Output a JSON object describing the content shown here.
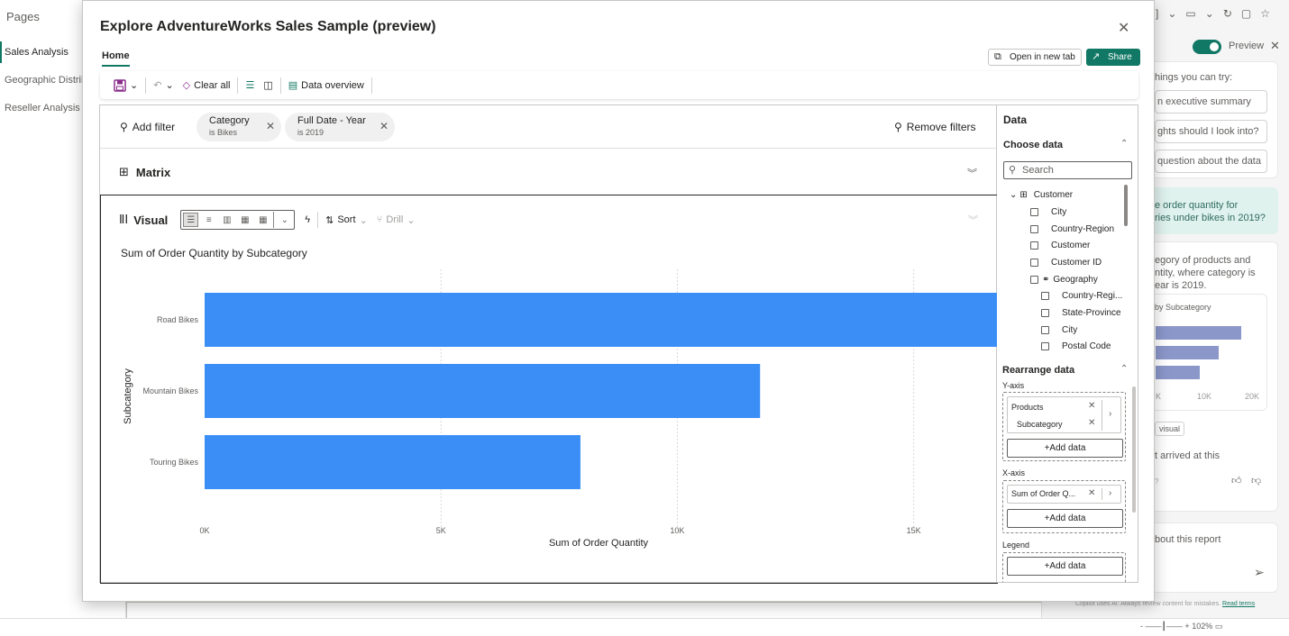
{
  "background": {
    "pages_title": "Pages",
    "pages": [
      "Sales Analysis",
      "Geographic Distrib",
      "Reseller Analysis"
    ]
  },
  "copilot": {
    "preview_label": "Preview",
    "things_try": "hings you can try:",
    "suggestions": [
      "n executive summary",
      "ghts should I look into?",
      "question about the data"
    ],
    "user_msg_1": "e order quantity for",
    "user_msg_2": "ries under bikes in 2019?",
    "resp_1": "egory of products and",
    "resp_2": "ntity, where category is",
    "resp_3": "ear is 2019.",
    "mini_chart_title": "by Subcategory",
    "mini_chart_values": [
      17500,
      13000,
      9000
    ],
    "mini_axis": [
      "K",
      "10K",
      "20K"
    ],
    "visual_btn": "visual",
    "arrived": "t arrived at this",
    "feedback_q": "?",
    "ask_placeholder": "bout this report",
    "footer_note": "Copilot uses AI. Always review content for mistakes.",
    "read_terms": "Read terms",
    "zoom": "102%"
  },
  "modal": {
    "title": "Explore AdventureWorks Sales Sample (preview)",
    "tab_home": "Home",
    "open_new_tab": "Open in new tab",
    "share": "Share",
    "toolbar": {
      "clear_all": "Clear all",
      "data_overview": "Data overview"
    },
    "filters": {
      "add_filter": "Add filter",
      "remove_filters": "Remove filters",
      "pills": [
        {
          "title": "Category",
          "sub": "is Bikes"
        },
        {
          "title": "Full Date - Year",
          "sub": "is 2019"
        }
      ]
    },
    "matrix_label": "Matrix",
    "visual": {
      "label": "Visual",
      "sort": "Sort",
      "drill": "Drill"
    }
  },
  "chart_data": {
    "type": "bar",
    "orientation": "horizontal",
    "title": "Sum of Order Quantity by Subcategory",
    "categories": [
      "Road Bikes",
      "Mountain Bikes",
      "Touring Bikes"
    ],
    "values": [
      17900,
      11750,
      7950
    ],
    "xlabel": "Sum of Order Quantity",
    "ylabel": "Subcategory",
    "xlim": [
      0,
      18000
    ],
    "xticks": [
      0,
      5000,
      10000,
      15000
    ],
    "xtick_labels": [
      "0K",
      "5K",
      "10K",
      "15K"
    ],
    "bar_color": "#3a8ef6",
    "grid": true
  },
  "data_pane": {
    "title": "Data",
    "choose_data": "Choose data",
    "search_placeholder": "Search",
    "table": "Customer",
    "fields": [
      "City",
      "Country-Region",
      "Customer",
      "Customer ID"
    ],
    "hierarchy": "Geography",
    "hierarchy_levels": [
      "Country-Regi...",
      "State-Province",
      "City",
      "Postal Code"
    ],
    "rearrange": "Rearrange data",
    "y_axis_label": "Y-axis",
    "y_items": [
      "Products",
      "Subcategory"
    ],
    "x_axis_label": "X-axis",
    "x_item": "Sum of Order Q...",
    "legend_label": "Legend",
    "add_data": "+Add data"
  },
  "colors": {
    "accent": "#117865",
    "bar": "#3a8ef6"
  }
}
